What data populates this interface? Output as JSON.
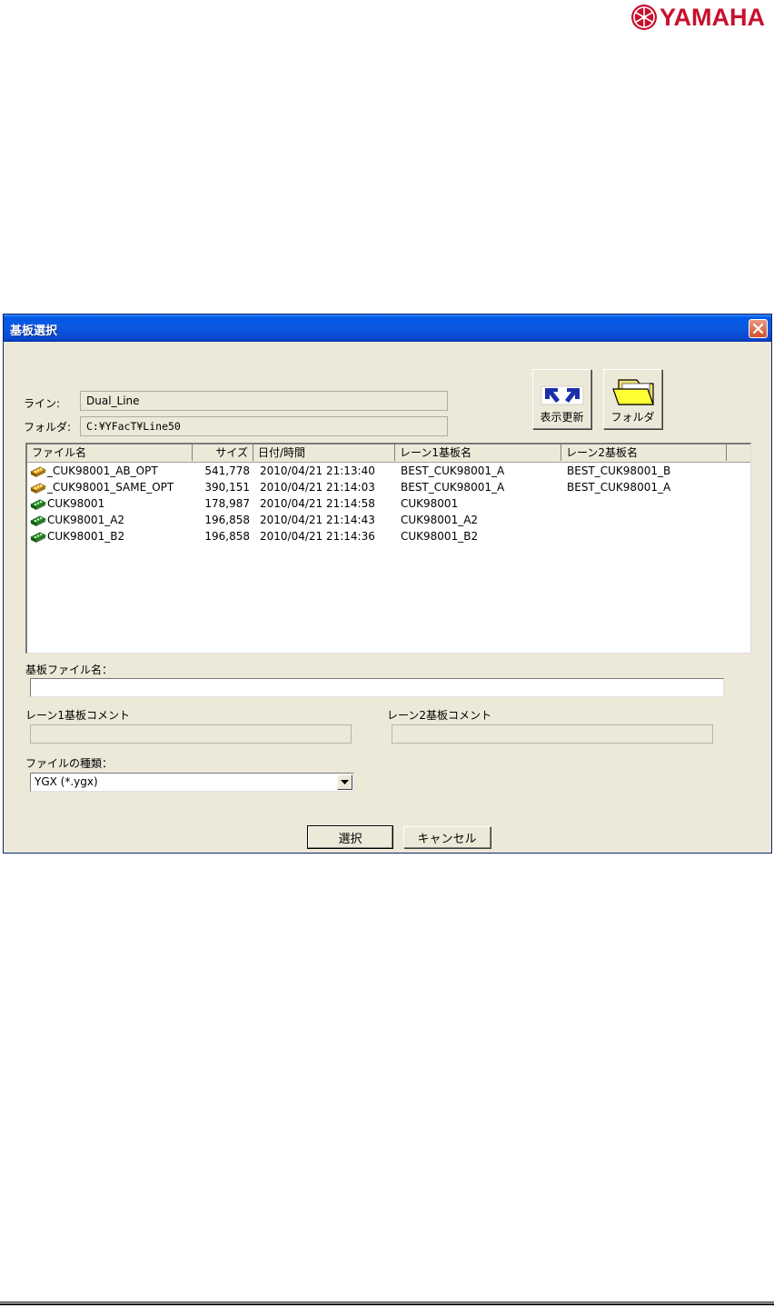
{
  "brand": {
    "name": "YAMAHA",
    "color": "#c8102e",
    "emblem": "tuning-fork-emblem-icon"
  },
  "dialog": {
    "title": "基板選択",
    "line_label": "ライン:",
    "line_value": "Dual_Line",
    "folder_label": "フォルダ:",
    "folder_value": "C:¥YFacT¥Line50",
    "refresh_button": "表示更新",
    "folder_button": "フォルダ",
    "list": {
      "columns": [
        "ファイル名",
        "サイズ",
        "日付/時間",
        "レーン1基板名",
        "レーン2基板名"
      ],
      "rows": [
        {
          "icon": "optimized-board-icon",
          "name": "_CUK98001_AB_OPT",
          "size": "541,778",
          "date": "2010/04/21 21:13:40",
          "lane1": "BEST_CUK98001_A",
          "lane2": "BEST_CUK98001_B"
        },
        {
          "icon": "optimized-board-icon",
          "name": "_CUK98001_SAME_OPT",
          "size": "390,151",
          "date": "2010/04/21 21:14:03",
          "lane1": "BEST_CUK98001_A",
          "lane2": "BEST_CUK98001_A"
        },
        {
          "icon": "board-icon",
          "name": "CUK98001",
          "size": "178,987",
          "date": "2010/04/21 21:14:58",
          "lane1": "CUK98001",
          "lane2": ""
        },
        {
          "icon": "board-icon",
          "name": "CUK98001_A2",
          "size": "196,858",
          "date": "2010/04/21 21:14:43",
          "lane1": "CUK98001_A2",
          "lane2": ""
        },
        {
          "icon": "board-icon",
          "name": "CUK98001_B2",
          "size": "196,858",
          "date": "2010/04/21 21:14:36",
          "lane1": "CUK98001_B2",
          "lane2": ""
        }
      ]
    },
    "board_file_label": "基板ファイル名：",
    "board_file_value": "",
    "lane1_comment_label": "レーン1基板コメント",
    "lane1_comment_value": "",
    "lane2_comment_label": "レーン2基板コメント",
    "lane2_comment_value": "",
    "file_type_label": "ファイルの種類：",
    "file_type_value": "YGX (*.ygx)",
    "select_button": "選択",
    "cancel_button": "キャンセル"
  }
}
